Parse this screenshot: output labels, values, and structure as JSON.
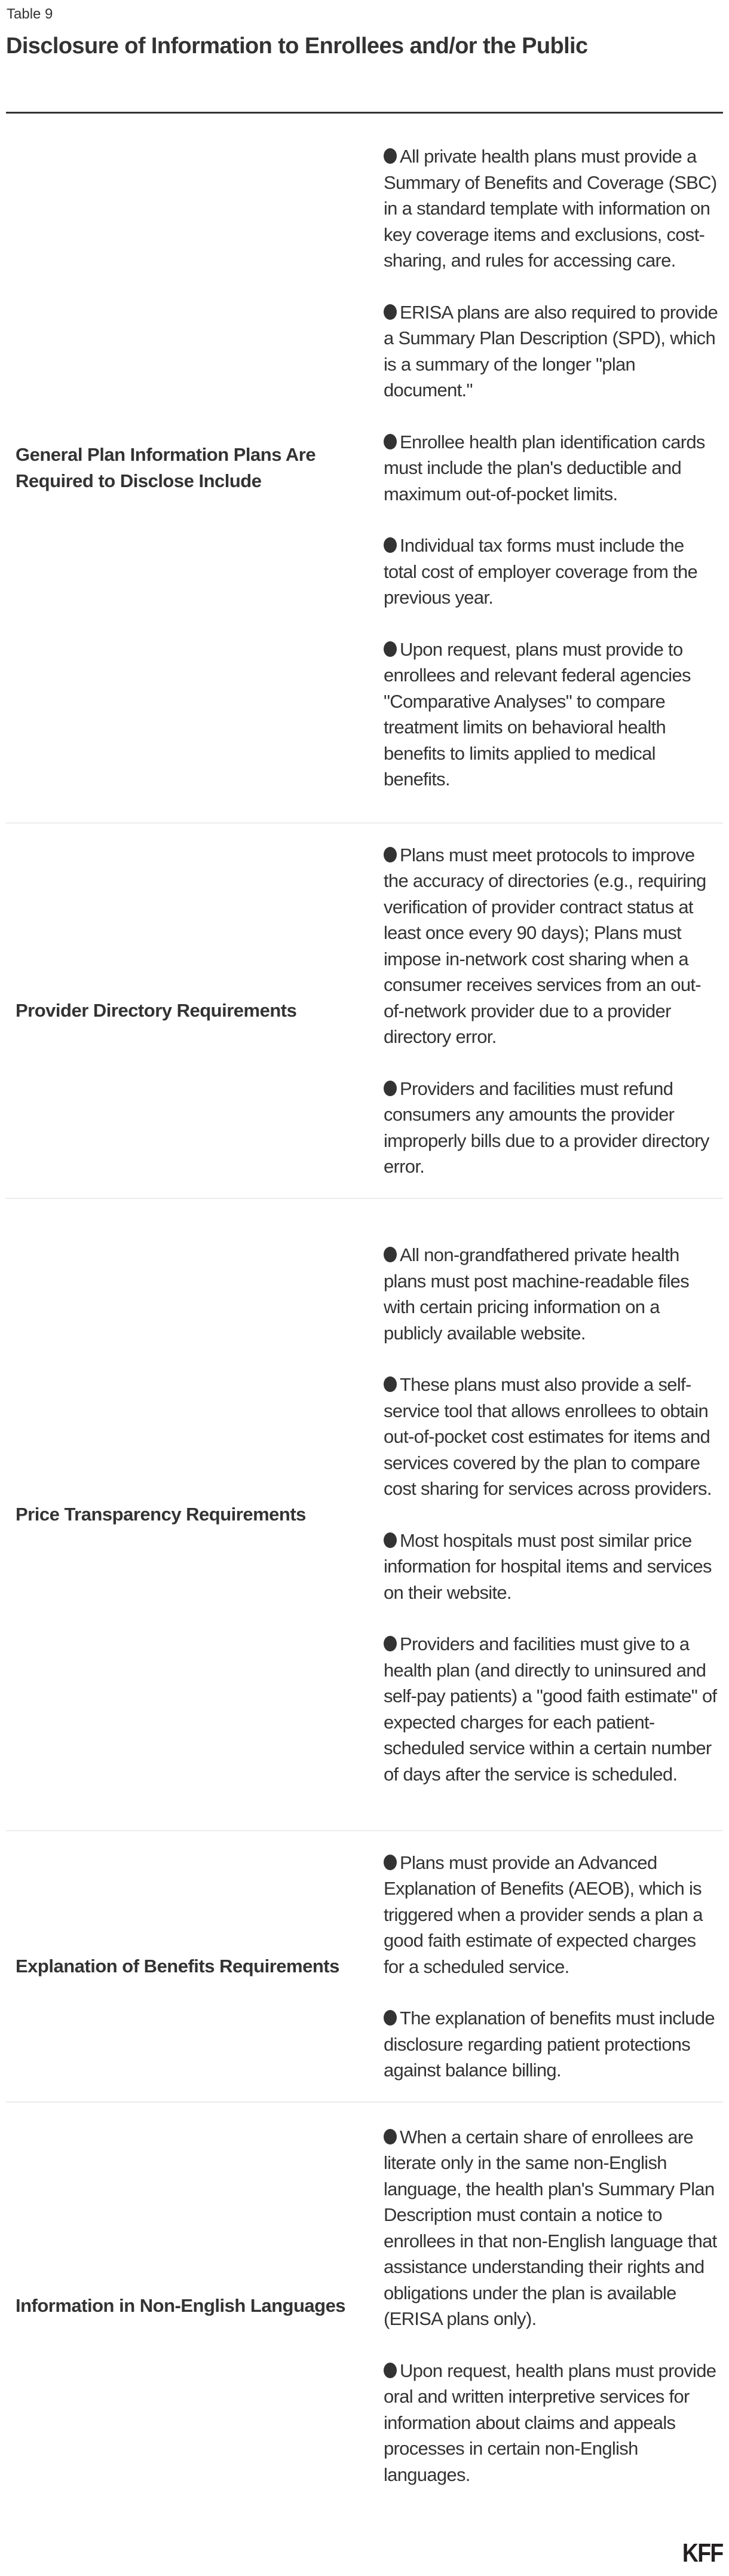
{
  "header": {
    "table_label": "Table 9",
    "title": "Disclosure of Information to Enrollees and/or the Public"
  },
  "rows": [
    {
      "label": "General Plan Information Plans Are Required to Disclose Include",
      "items": [
        "All private health plans must provide a Summary of Benefits and Coverage (SBC) in a standard template with information on key coverage items and exclusions, cost-sharing, and rules for accessing care.",
        "ERISA plans are also required to provide a Summary Plan Description (SPD), which is a summary of the longer \"plan document.\"",
        "Enrollee health plan identification cards must include the plan's deductible and maximum out-of-pocket limits.",
        "Individual tax forms must include the total cost of employer coverage from the previous year.",
        "Upon request, plans must provide to enrollees and relevant federal agencies \"Comparative Analyses\" to compare treatment limits on behavioral health benefits to limits applied to medical benefits."
      ]
    },
    {
      "label": "Provider Directory Requirements",
      "items": [
        "Plans must meet protocols to improve the accuracy of directories (e.g., requiring verification of provider contract status at least once every 90 days); Plans must impose in-network cost sharing when a consumer receives services from an out-of-network provider due to a provider directory error.",
        "Providers and facilities must refund consumers any amounts the provider improperly bills due to a provider directory error."
      ]
    },
    {
      "label": "Price Transparency Requirements",
      "items": [
        "All non-grandfathered private health plans must post machine-readable files with certain pricing information on a publicly available website.",
        "These plans must also provide a self-service tool that allows enrollees to obtain out-of-pocket cost estimates for items and services covered by the plan to compare cost sharing for services across providers.",
        "Most hospitals must post similar price information for hospital items and services on their website.",
        "Providers and facilities must give to a health plan (and directly to uninsured and self-pay patients) a \"good faith estimate\" of expected charges for each patient-scheduled service within a certain number of days after the service is scheduled."
      ]
    },
    {
      "label": "Explanation of Benefits Requirements",
      "items": [
        "Plans must provide an Advanced Explanation of Benefits (AEOB), which is triggered when a provider sends a plan a good faith estimate of expected charges for a scheduled service.",
        "The explanation of benefits must include disclosure regarding patient protections against balance billing."
      ]
    },
    {
      "label": "Information in Non-English Languages",
      "items": [
        "When a certain share of enrollees are literate only in the same non-English language, the health plan's Summary Plan Description must contain a notice to enrollees in that non-English language that assistance understanding their rights and obligations under the plan is available (ERISA plans only).",
        "Upon request, health plans must provide oral and written interpretive services for information about claims and appeals processes in certain non-English languages."
      ]
    }
  ],
  "footer": {
    "logo_text": "KFF"
  },
  "colors": {
    "text": "#333333",
    "top_rule": "#333333",
    "row_divider": "#ececec",
    "logo": "#231f20"
  }
}
